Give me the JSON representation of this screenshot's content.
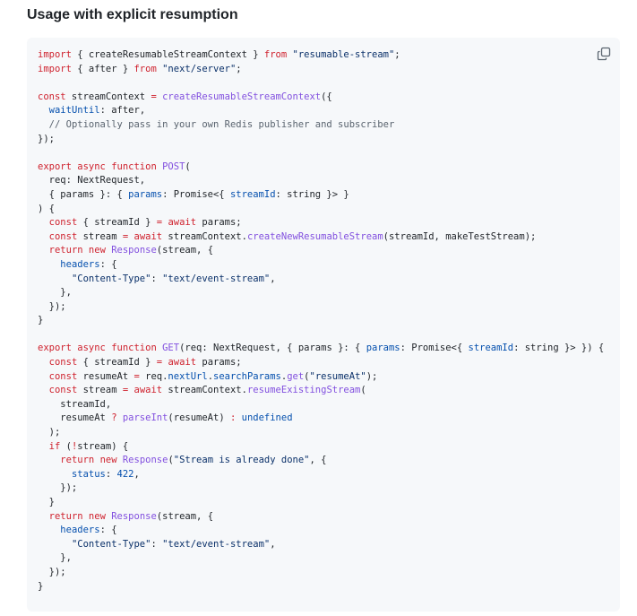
{
  "title": "Usage with explicit resumption",
  "copy_icon": "copy-icon",
  "colors": {
    "keyword": "#cf222e",
    "function": "#8250df",
    "string": "#0a3069",
    "property": "#0550ae",
    "comment": "#59636e",
    "text": "#1f2328",
    "code_bg": "#f6f8fa"
  },
  "code_lines": [
    [
      [
        "kw",
        "import"
      ],
      [
        "p",
        " { createResumableStreamContext } "
      ],
      [
        "kw",
        "from"
      ],
      [
        "p",
        " "
      ],
      [
        "str",
        "\"resumable-stream\""
      ],
      [
        "p",
        ";"
      ]
    ],
    [
      [
        "kw",
        "import"
      ],
      [
        "p",
        " { after } "
      ],
      [
        "kw",
        "from"
      ],
      [
        "p",
        " "
      ],
      [
        "str",
        "\"next/server\""
      ],
      [
        "p",
        ";"
      ]
    ],
    [],
    [
      [
        "kw",
        "const"
      ],
      [
        "p",
        " streamContext "
      ],
      [
        "kw",
        "="
      ],
      [
        "p",
        " "
      ],
      [
        "fn",
        "createResumableStreamContext"
      ],
      [
        "p",
        "({"
      ]
    ],
    [
      [
        "p",
        "  "
      ],
      [
        "prop",
        "waitUntil"
      ],
      [
        "p",
        ": after,"
      ]
    ],
    [
      [
        "p",
        "  "
      ],
      [
        "cm",
        "// Optionally pass in your own Redis publisher and subscriber"
      ]
    ],
    [
      [
        "p",
        "});"
      ]
    ],
    [],
    [
      [
        "kw",
        "export"
      ],
      [
        "p",
        " "
      ],
      [
        "kw",
        "async"
      ],
      [
        "p",
        " "
      ],
      [
        "kw",
        "function"
      ],
      [
        "p",
        " "
      ],
      [
        "fn",
        "POST"
      ],
      [
        "p",
        "("
      ]
    ],
    [
      [
        "p",
        "  req: NextRequest,"
      ]
    ],
    [
      [
        "p",
        "  { params }: { "
      ],
      [
        "prop",
        "params"
      ],
      [
        "p",
        ": Promise<{ "
      ],
      [
        "prop",
        "streamId"
      ],
      [
        "p",
        ": string }> }"
      ]
    ],
    [
      [
        "p",
        ") {"
      ]
    ],
    [
      [
        "p",
        "  "
      ],
      [
        "kw",
        "const"
      ],
      [
        "p",
        " { streamId } "
      ],
      [
        "kw",
        "="
      ],
      [
        "p",
        " "
      ],
      [
        "kw",
        "await"
      ],
      [
        "p",
        " params;"
      ]
    ],
    [
      [
        "p",
        "  "
      ],
      [
        "kw",
        "const"
      ],
      [
        "p",
        " stream "
      ],
      [
        "kw",
        "="
      ],
      [
        "p",
        " "
      ],
      [
        "kw",
        "await"
      ],
      [
        "p",
        " streamContext."
      ],
      [
        "fn",
        "createNewResumableStream"
      ],
      [
        "p",
        "(streamId, makeTestStream);"
      ]
    ],
    [
      [
        "p",
        "  "
      ],
      [
        "kw",
        "return"
      ],
      [
        "p",
        " "
      ],
      [
        "kw",
        "new"
      ],
      [
        "p",
        " "
      ],
      [
        "fn",
        "Response"
      ],
      [
        "p",
        "(stream, {"
      ]
    ],
    [
      [
        "p",
        "    "
      ],
      [
        "prop",
        "headers"
      ],
      [
        "p",
        ": {"
      ]
    ],
    [
      [
        "p",
        "      "
      ],
      [
        "str",
        "\"Content-Type\""
      ],
      [
        "p",
        ": "
      ],
      [
        "str",
        "\"text/event-stream\""
      ],
      [
        "p",
        ","
      ]
    ],
    [
      [
        "p",
        "    },"
      ]
    ],
    [
      [
        "p",
        "  });"
      ]
    ],
    [
      [
        "p",
        "}"
      ]
    ],
    [],
    [
      [
        "kw",
        "export"
      ],
      [
        "p",
        " "
      ],
      [
        "kw",
        "async"
      ],
      [
        "p",
        " "
      ],
      [
        "kw",
        "function"
      ],
      [
        "p",
        " "
      ],
      [
        "fn",
        "GET"
      ],
      [
        "p",
        "(req: NextRequest, { params }: { "
      ],
      [
        "prop",
        "params"
      ],
      [
        "p",
        ": Promise<{ "
      ],
      [
        "prop",
        "streamId"
      ],
      [
        "p",
        ": string }> }) {"
      ]
    ],
    [
      [
        "p",
        "  "
      ],
      [
        "kw",
        "const"
      ],
      [
        "p",
        " { streamId } "
      ],
      [
        "kw",
        "="
      ],
      [
        "p",
        " "
      ],
      [
        "kw",
        "await"
      ],
      [
        "p",
        " params;"
      ]
    ],
    [
      [
        "p",
        "  "
      ],
      [
        "kw",
        "const"
      ],
      [
        "p",
        " resumeAt "
      ],
      [
        "kw",
        "="
      ],
      [
        "p",
        " req."
      ],
      [
        "prop",
        "nextUrl"
      ],
      [
        "p",
        "."
      ],
      [
        "prop",
        "searchParams"
      ],
      [
        "p",
        "."
      ],
      [
        "fn",
        "get"
      ],
      [
        "p",
        "("
      ],
      [
        "str",
        "\"resumeAt\""
      ],
      [
        "p",
        ");"
      ]
    ],
    [
      [
        "p",
        "  "
      ],
      [
        "kw",
        "const"
      ],
      [
        "p",
        " stream "
      ],
      [
        "kw",
        "="
      ],
      [
        "p",
        " "
      ],
      [
        "kw",
        "await"
      ],
      [
        "p",
        " streamContext."
      ],
      [
        "fn",
        "resumeExistingStream"
      ],
      [
        "p",
        "("
      ]
    ],
    [
      [
        "p",
        "    streamId,"
      ]
    ],
    [
      [
        "p",
        "    resumeAt "
      ],
      [
        "kw",
        "?"
      ],
      [
        "p",
        " "
      ],
      [
        "fn",
        "parseInt"
      ],
      [
        "p",
        "(resumeAt) "
      ],
      [
        "kw",
        ":"
      ],
      [
        "p",
        " "
      ],
      [
        "prop",
        "undefined"
      ]
    ],
    [
      [
        "p",
        "  );"
      ]
    ],
    [
      [
        "p",
        "  "
      ],
      [
        "kw",
        "if"
      ],
      [
        "p",
        " ("
      ],
      [
        "kw",
        "!"
      ],
      [
        "p",
        "stream) {"
      ]
    ],
    [
      [
        "p",
        "    "
      ],
      [
        "kw",
        "return"
      ],
      [
        "p",
        " "
      ],
      [
        "kw",
        "new"
      ],
      [
        "p",
        " "
      ],
      [
        "fn",
        "Response"
      ],
      [
        "p",
        "("
      ],
      [
        "str",
        "\"Stream is already done\""
      ],
      [
        "p",
        ", {"
      ]
    ],
    [
      [
        "p",
        "      "
      ],
      [
        "prop",
        "status"
      ],
      [
        "p",
        ": "
      ],
      [
        "prop",
        "422"
      ],
      [
        "p",
        ","
      ]
    ],
    [
      [
        "p",
        "    });"
      ]
    ],
    [
      [
        "p",
        "  }"
      ]
    ],
    [
      [
        "p",
        "  "
      ],
      [
        "kw",
        "return"
      ],
      [
        "p",
        " "
      ],
      [
        "kw",
        "new"
      ],
      [
        "p",
        " "
      ],
      [
        "fn",
        "Response"
      ],
      [
        "p",
        "(stream, {"
      ]
    ],
    [
      [
        "p",
        "    "
      ],
      [
        "prop",
        "headers"
      ],
      [
        "p",
        ": {"
      ]
    ],
    [
      [
        "p",
        "      "
      ],
      [
        "str",
        "\"Content-Type\""
      ],
      [
        "p",
        ": "
      ],
      [
        "str",
        "\"text/event-stream\""
      ],
      [
        "p",
        ","
      ]
    ],
    [
      [
        "p",
        "    },"
      ]
    ],
    [
      [
        "p",
        "  });"
      ]
    ],
    [
      [
        "p",
        "}"
      ]
    ]
  ]
}
